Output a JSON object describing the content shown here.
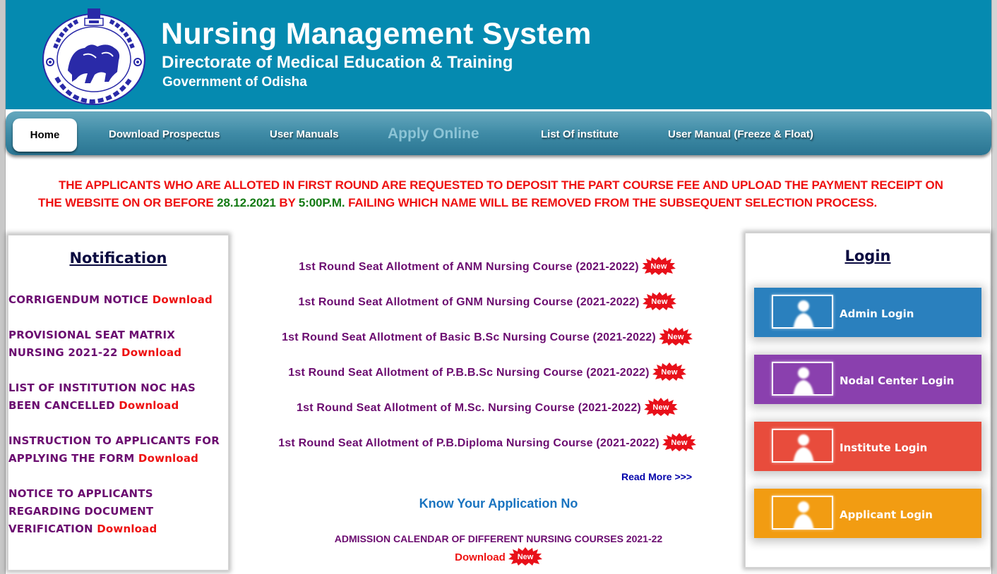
{
  "header": {
    "title": "Nursing Management System",
    "subtitle": "Directorate of Medical Education & Training",
    "org": "Government of Odisha",
    "logo_icon": "odisha-government-emblem",
    "background_color": "#058ab0"
  },
  "nav": {
    "items": [
      {
        "label": "Home",
        "active": true
      },
      {
        "label": "Download Prospectus",
        "active": false
      },
      {
        "label": "User Manuals",
        "active": false
      },
      {
        "label": "Apply Online",
        "active": false,
        "disabled": true
      },
      {
        "label": "List Of institute",
        "active": false
      },
      {
        "label": "User Manual (Freeze & Float)",
        "active": false
      }
    ]
  },
  "notice": {
    "line1": "THE APPLICANTS WHO ARE ALLOTED IN FIRST ROUND ARE REQUESTED TO DEPOSIT THE PART COURSE FEE AND UPLOAD THE PAYMENT RECEIPT ON",
    "line2_pre": "THE WEBSITE ON OR BEFORE ",
    "date": "28.12.2021",
    "line2_mid": " BY ",
    "time": "5:00P.M.",
    "line2_post": " FAILING WHICH NAME WILL BE REMOVED FROM THE SUBSEQUENT SELECTION PROCESS.",
    "color_main": "#ee1111",
    "color_highlight": "#147a14"
  },
  "notifications": {
    "title": "Notification",
    "items": [
      {
        "text": "CORRIGENDUM NOTICE",
        "link": "Download"
      },
      {
        "text": "PROVISIONAL SEAT MATRIX NURSING 2021-22",
        "link": "Download"
      },
      {
        "text": "LIST OF INSTITUTION NOC HAS BEEN CANCELLED",
        "link": "Download"
      },
      {
        "text": "INSTRUCTION TO APPLICANTS FOR APPLYING THE FORM",
        "link": "Download"
      },
      {
        "text": "NOTICE TO APPLICANTS REGARDING DOCUMENT VERIFICATION",
        "link": "Download"
      }
    ]
  },
  "allotments": {
    "badge": "New",
    "items": [
      {
        "label": "1st Round Seat Allotment of ANM Nursing Course (2021-2022)"
      },
      {
        "label": "1st Round Seat Allotment of GNM Nursing Course (2021-2022)"
      },
      {
        "label": "1st Round Seat Allotment of Basic B.Sc Nursing Course (2021-2022)"
      },
      {
        "label": "1st Round Seat Allotment of P.B.B.Sc Nursing Course (2021-2022)"
      },
      {
        "label": "1st Round Seat Allotment of M.Sc. Nursing Course (2021-2022)"
      },
      {
        "label": "1st Round Seat Allotment of P.B.Diploma Nursing Course (2021-2022)"
      }
    ],
    "read_more": "Read More >>>",
    "know_application": "Know Your Application No",
    "admission_calendar": "ADMISSION CALENDAR OF DIFFERENT NURSING COURSES 2021-22",
    "admission_download": "Download"
  },
  "login": {
    "title": "Login",
    "buttons": [
      {
        "label": "Admin Login",
        "color": "#2a80be",
        "icon": "user-icon"
      },
      {
        "label": "Nodal Center Login",
        "color": "#8a40ae",
        "icon": "user-icon"
      },
      {
        "label": "Institute Login",
        "color": "#e84c3c",
        "icon": "user-icon"
      },
      {
        "label": "Applicant Login",
        "color": "#f29c12",
        "icon": "user-icon"
      }
    ]
  }
}
